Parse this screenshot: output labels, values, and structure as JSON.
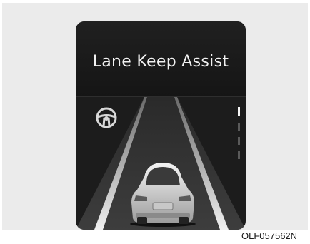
{
  "display": {
    "title": "Lane Keep Assist",
    "figure_code": "OLF057562N",
    "icons": [
      "steering-wheel-icon",
      "vehicle-rear-icon"
    ],
    "colors": {
      "frame_background": "#ebebeb",
      "screen_background": "#1c1c1c",
      "text": "#f2f2f2",
      "lane_line": "#e8e8e8"
    }
  }
}
